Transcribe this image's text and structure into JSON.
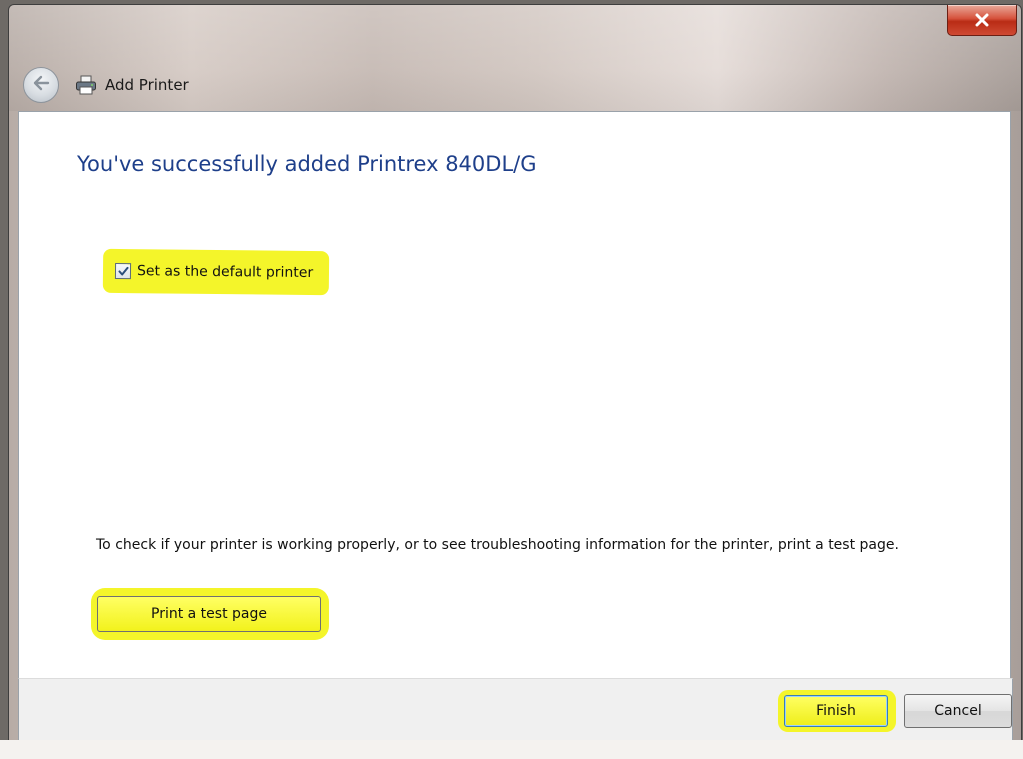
{
  "window": {
    "title": "Add Printer",
    "close_glyph": "x"
  },
  "icons": {
    "back": "back-arrow-icon",
    "printer": "printer-icon",
    "close": "close-icon",
    "check": "checkmark-icon"
  },
  "main": {
    "heading": "You've successfully added Printrex 840DL/G",
    "default_checkbox": {
      "label": "Set as the default printer",
      "checked": true
    },
    "info_text": "To check if your printer is working properly, or to see troubleshooting information for the printer, print a test page.",
    "test_button_label": "Print a test page"
  },
  "footer": {
    "finish_label": "Finish",
    "cancel_label": "Cancel"
  },
  "colors": {
    "heading": "#1e3f8a",
    "highlight": "#f4f52a",
    "close_button": "#c9412a"
  }
}
